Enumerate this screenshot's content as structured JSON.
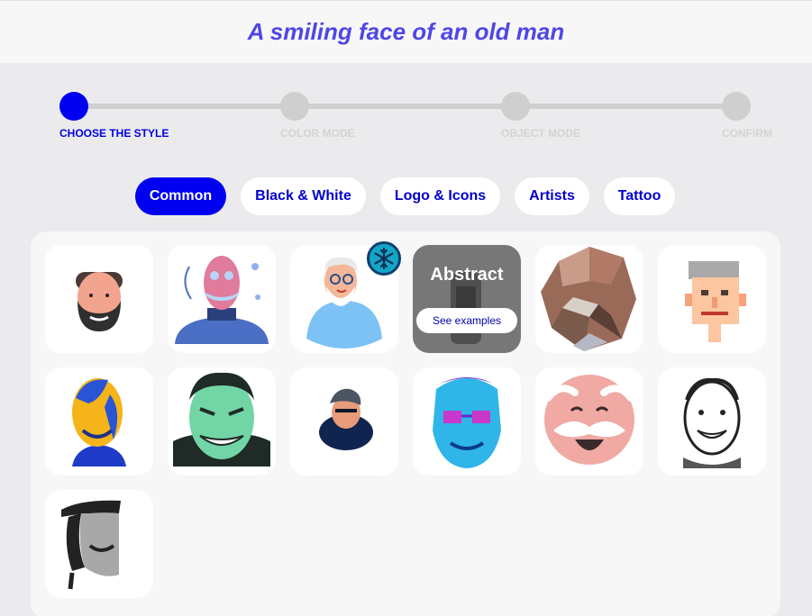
{
  "header": {
    "title": "A smiling face of an old man"
  },
  "stepper": {
    "steps": [
      {
        "label": "CHOOSE THE STYLE",
        "active": true
      },
      {
        "label": "COLOR MODE",
        "active": false
      },
      {
        "label": "OBJECT MODE",
        "active": false
      },
      {
        "label": "CONFIRM",
        "active": false
      }
    ]
  },
  "tabs": [
    {
      "label": "Common",
      "active": true
    },
    {
      "label": "Black & White",
      "active": false
    },
    {
      "label": "Logo & Icons",
      "active": false
    },
    {
      "label": "Artists",
      "active": false
    },
    {
      "label": "Tattoo",
      "active": false
    }
  ],
  "gallery": {
    "abstract_card": {
      "title": "Abstract",
      "button_label": "See examples"
    },
    "styles": [
      "bearded-man-flat",
      "pink-face-illustration",
      "white-haired-man-glasses",
      "abstract",
      "lowpoly-face",
      "pixel-face",
      "yellow-blue-face",
      "green-grinning-man",
      "small-capped-man",
      "neon-glasses-face",
      "santa-style-laughing-face",
      "sketch-smiling-man",
      "bw-hat-man"
    ]
  },
  "colors": {
    "accent": "#0000f0",
    "title": "#4f46e5",
    "inactive": "#cfcfcf"
  },
  "icons": {
    "badge": "snowflake-icon"
  }
}
